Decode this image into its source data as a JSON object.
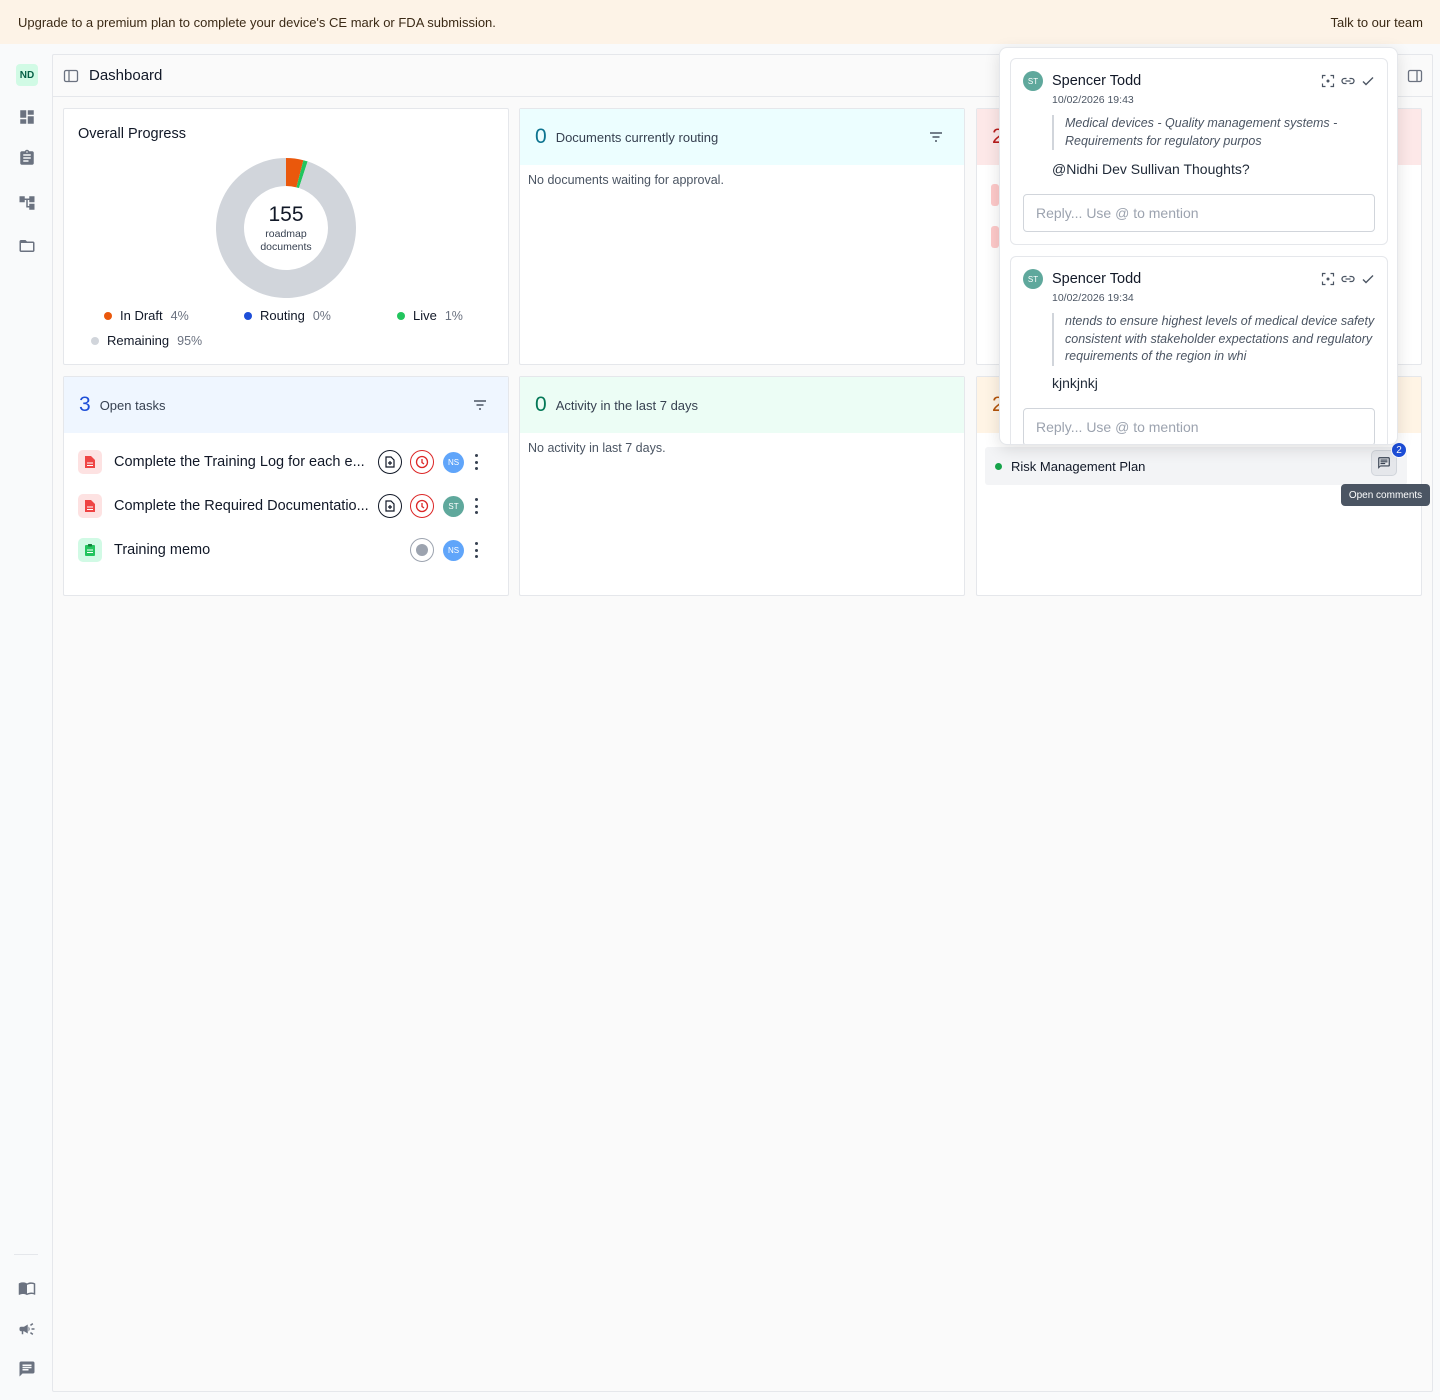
{
  "banner": {
    "message": "Upgrade to a premium plan to complete your device's CE mark or FDA submission.",
    "cta": "Talk to our team"
  },
  "sidebar": {
    "avatar": "ND",
    "items": [
      {
        "icon": "dashboard-icon"
      },
      {
        "icon": "clipboard-icon"
      },
      {
        "icon": "hierarchy-icon"
      },
      {
        "icon": "folder-icon"
      }
    ],
    "bottom_items": [
      {
        "icon": "book-icon"
      },
      {
        "icon": "megaphone-icon"
      },
      {
        "icon": "chat-icon"
      }
    ]
  },
  "header": {
    "title": "Dashboard"
  },
  "overall_progress": {
    "title": "Overall Progress",
    "center_value": "155",
    "center_label": "roadmap documents",
    "legend": [
      {
        "label": "In Draft",
        "pct": "4%",
        "color": "#ea580c",
        "value": 4
      },
      {
        "label": "Routing",
        "pct": "0%",
        "color": "#1d4ed8",
        "value": 0
      },
      {
        "label": "Live",
        "pct": "1%",
        "color": "#22c55e",
        "value": 1
      },
      {
        "label": "Remaining",
        "pct": "95%",
        "color": "#d1d5db",
        "value": 95
      }
    ]
  },
  "routing": {
    "count": "0",
    "label": "Documents currently routing",
    "empty": "No documents waiting for approval.",
    "accent": "#ecfeff"
  },
  "open_tasks": {
    "count": "3",
    "label": "Open tasks",
    "accent": "#eff6ff",
    "tasks": [
      {
        "name": "Complete the Training Log for each e...",
        "assignee": "NS",
        "assignee_color": "#60a5fa"
      },
      {
        "name": "Complete the Required Documentatio...",
        "assignee": "ST",
        "assignee_color": "#5fa89c"
      },
      {
        "name": "Training memo",
        "assignee": "NS",
        "assignee_color": "#60a5fa"
      }
    ]
  },
  "activity": {
    "count": "0",
    "label": "Activity in the last 7 days",
    "empty": "No activity in last 7 days.",
    "accent": "#ecfdf5"
  },
  "right_cards": {
    "top_count": "2",
    "bottom_count": "2",
    "risk_item": "Risk Management Plan",
    "comment_count": "2",
    "tooltip": "Open comments"
  },
  "comments": [
    {
      "initials": "ST",
      "author": "Spencer Todd",
      "time": "10/02/2026 19:43",
      "quote": "Medical devices - Quality management systems - Requirements for regulatory purpos",
      "body": "@Nidhi Dev Sullivan Thoughts?",
      "reply_placeholder": "Reply... Use @ to mention"
    },
    {
      "initials": "ST",
      "author": "Spencer Todd",
      "time": "10/02/2026 19:34",
      "quote": "ntends to ensure highest levels of medical device safety consistent with stakeholder expectations and regulatory requirements of the region in whi",
      "body": "kjnkjnkj",
      "reply_placeholder": "Reply... Use @ to mention"
    }
  ]
}
